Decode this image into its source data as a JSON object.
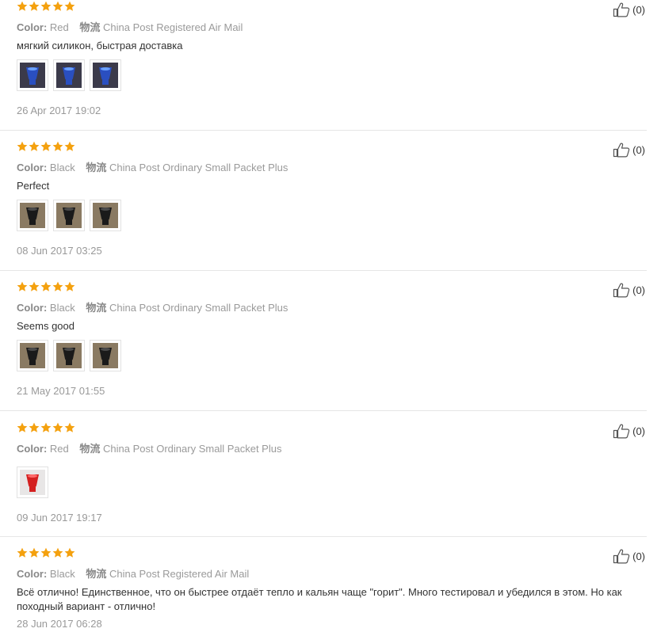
{
  "colors": {
    "star": "#f4a10f",
    "divider": "#e6e6e6",
    "muted": "#999999"
  },
  "labels": {
    "color_key": "Color:",
    "shipping_key": "物流"
  },
  "reviews": [
    {
      "stars": 5,
      "color": "Red",
      "shipping": "China Post Registered Air Mail",
      "text": "мягкий силикон, быстрая доставка",
      "photos": [
        "blue-bowl-photo",
        "blue-bowl-photo",
        "blue-bowl-photo"
      ],
      "date": "26 Apr 2017 19:02",
      "likes": "(0)"
    },
    {
      "stars": 5,
      "color": "Black",
      "shipping": "China Post Ordinary Small Packet Plus",
      "text": "Perfect",
      "photos": [
        "black-bowl-photo",
        "black-bowl-photo",
        "black-bowl-photo"
      ],
      "date": "08 Jun 2017 03:25",
      "likes": "(0)"
    },
    {
      "stars": 5,
      "color": "Black",
      "shipping": "China Post Ordinary Small Packet Plus",
      "text": "Seems good",
      "photos": [
        "black-bowl-photo",
        "black-bowl-photo",
        "black-bowl-photo"
      ],
      "date": "21 May 2017 01:55",
      "likes": "(0)"
    },
    {
      "stars": 5,
      "color": "Red",
      "shipping": "China Post Ordinary Small Packet Plus",
      "text": "",
      "photos": [
        "red-bowl-photo"
      ],
      "date": "09 Jun 2017 19:17",
      "likes": "(0)"
    },
    {
      "stars": 5,
      "color": "Black",
      "shipping": "China Post Registered Air Mail",
      "text": "Всё отлично! Единственное, что он быстрее отдаёт тепло и кальян чаще \"горит\". Много тестировал и убедился в этом. Но как походный вариант - отлично!",
      "photos": [],
      "date": "28 Jun 2017 06:28",
      "likes": "(0)"
    }
  ]
}
